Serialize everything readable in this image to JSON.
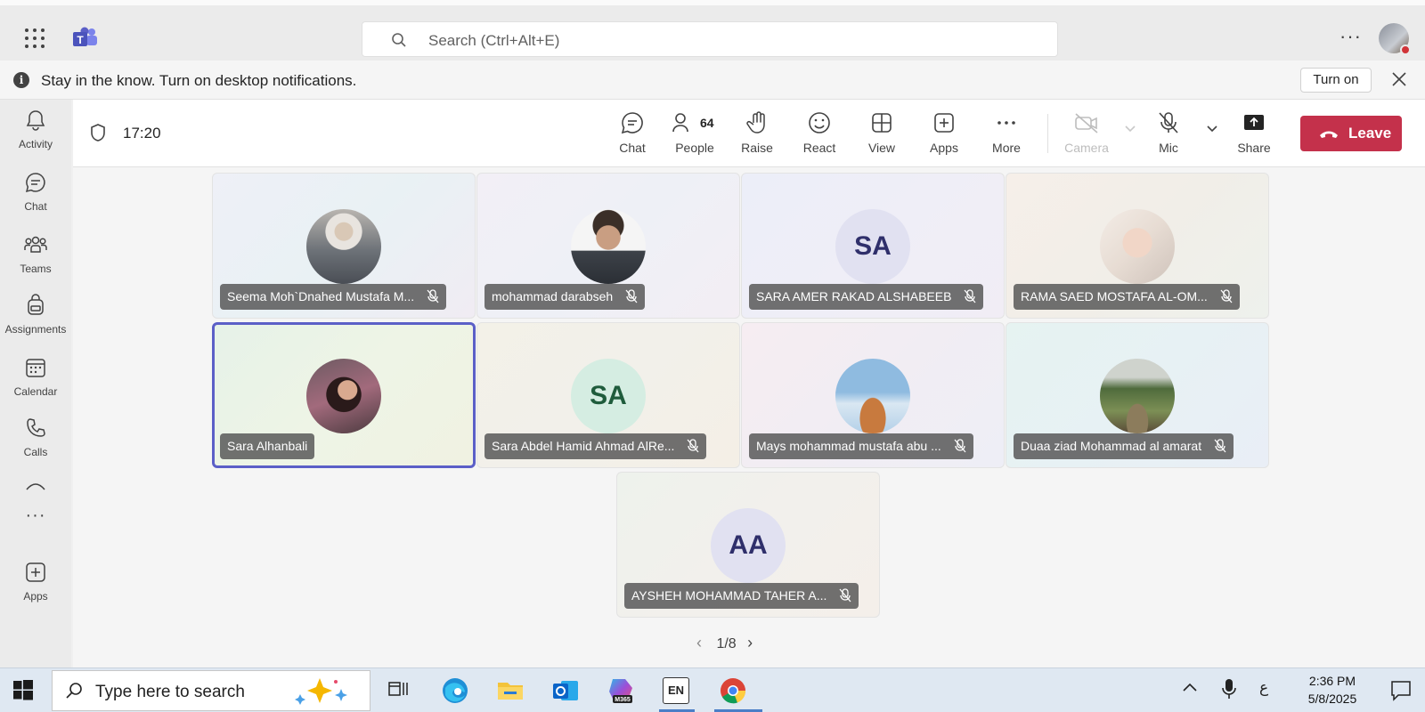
{
  "topbar": {
    "search_placeholder": "Search (Ctrl+Alt+E)",
    "more_label": "···"
  },
  "notification": {
    "message": "Stay in the know. Turn on desktop notifications.",
    "turn_on_label": "Turn on"
  },
  "rail": {
    "items": [
      {
        "label": "Activity"
      },
      {
        "label": "Chat"
      },
      {
        "label": "Teams"
      },
      {
        "label": "Assignments"
      },
      {
        "label": "Calendar"
      },
      {
        "label": "Calls"
      },
      {
        "label": "Apps"
      }
    ]
  },
  "callbar": {
    "timer": "17:20",
    "chat_label": "Chat",
    "people_label": "People",
    "people_count": "64",
    "raise_label": "Raise",
    "react_label": "React",
    "view_label": "View",
    "apps_label": "Apps",
    "more_label": "More",
    "camera_label": "Camera",
    "mic_label": "Mic",
    "share_label": "Share",
    "leave_label": "Leave"
  },
  "participants": [
    {
      "name": "Seema Moh`Dnahed Mustafa M...",
      "avatar": "photo"
    },
    {
      "name": "mohammad darabseh",
      "avatar": "photo"
    },
    {
      "name": "SARA AMER RAKAD ALSHABEEB",
      "initials": "SA"
    },
    {
      "name": "RAMA SAED MOSTAFA AL-OM...",
      "avatar": "photo"
    },
    {
      "name": "Sara Alhanbali",
      "avatar": "photo"
    },
    {
      "name": "Sara Abdel Hamid Ahmad AlRe...",
      "initials": "SA"
    },
    {
      "name": "Mays mohammad mustafa abu ...",
      "avatar": "photo"
    },
    {
      "name": "Duaa ziad Mohammad al amarat",
      "avatar": "photo"
    },
    {
      "name": "AYSHEH MOHAMMAD TAHER A...",
      "initials": "AA"
    }
  ],
  "pager": {
    "label": "1/8"
  },
  "taskbar": {
    "search_placeholder": "Type here to search",
    "lang": "EN",
    "input_indicator": "ع",
    "time": "2:36 PM",
    "date": "5/8/2025"
  },
  "colors": {
    "leave": "#c4314b",
    "active_speaker": "#5b5fc7",
    "teams_brand": "#5b5fc7"
  }
}
